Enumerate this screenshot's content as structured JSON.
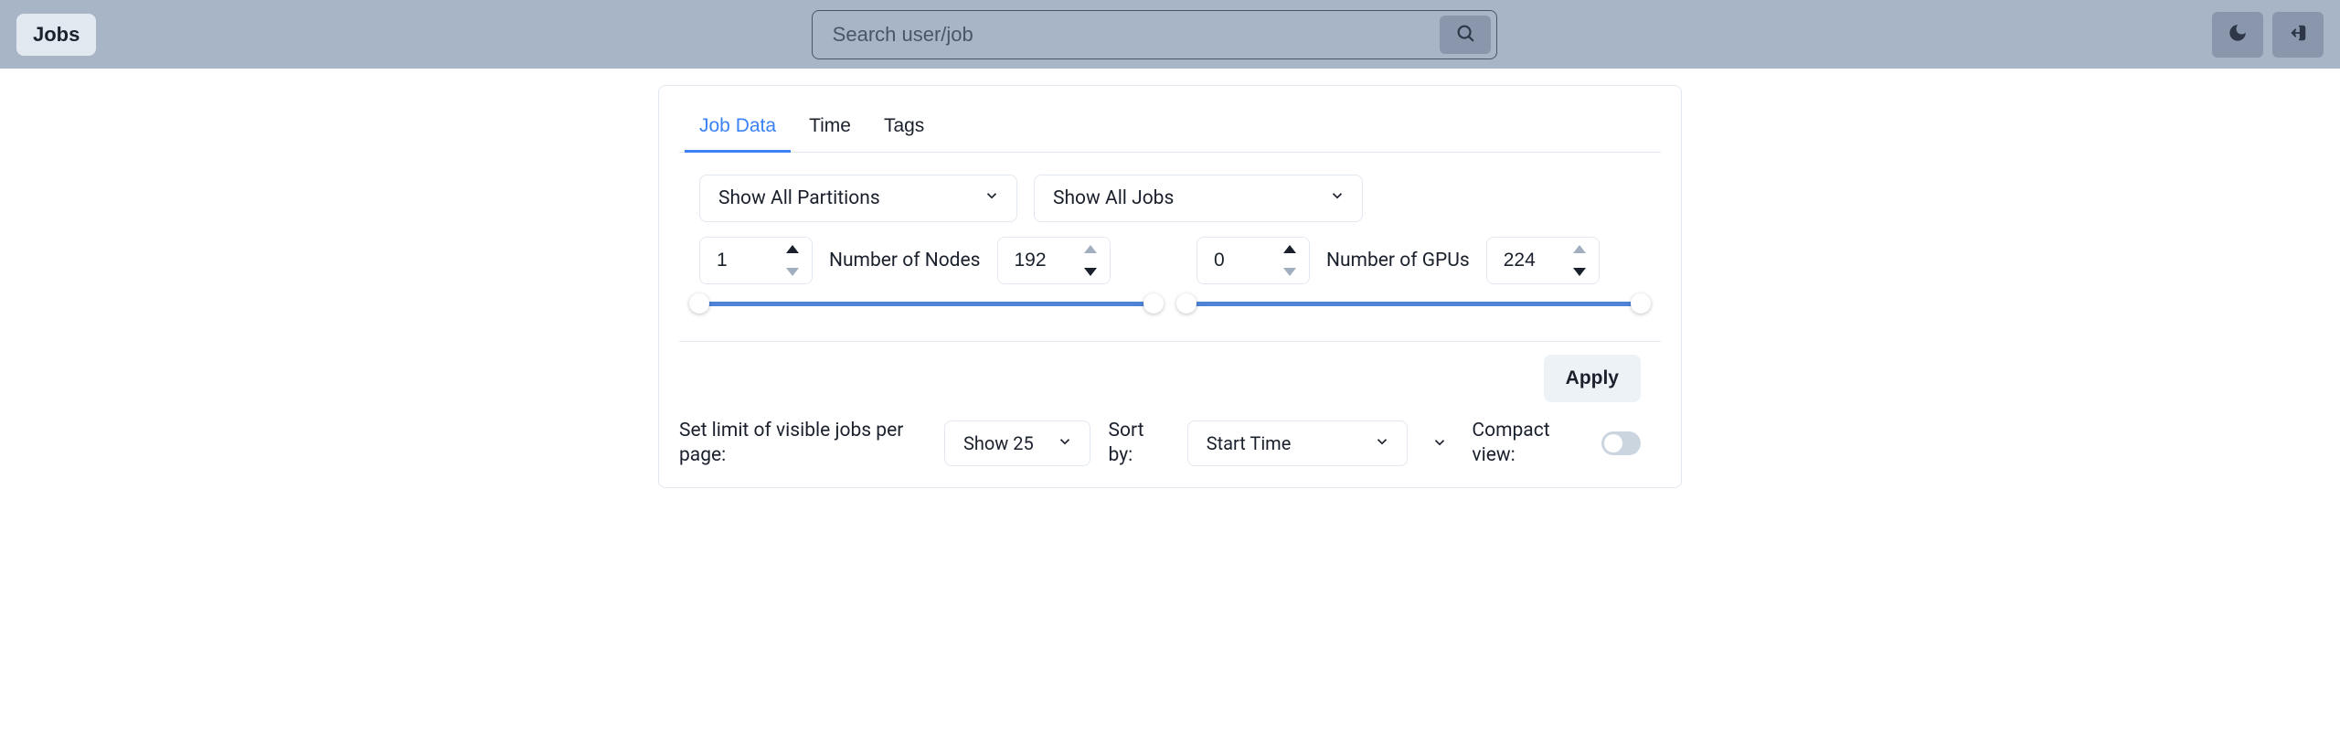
{
  "header": {
    "brand": "Jobs",
    "search_placeholder": "Search user/job"
  },
  "tabs": {
    "job_data": "Job Data",
    "time": "Time",
    "tags": "Tags"
  },
  "filters": {
    "partitions_label": "Show All Partitions",
    "jobs_label": "Show All Jobs",
    "nodes_label": "Number of Nodes",
    "nodes_min": "1",
    "nodes_max": "192",
    "gpus_label": "Number of GPUs",
    "gpus_min": "0",
    "gpus_max": "224"
  },
  "footer": {
    "apply": "Apply",
    "limit_label": "Set limit of visible jobs per page:",
    "limit_value": "Show 25",
    "sort_by_label": "Sort by:",
    "sort_by_value": "Start Time",
    "compact_label": "Compact view:"
  }
}
